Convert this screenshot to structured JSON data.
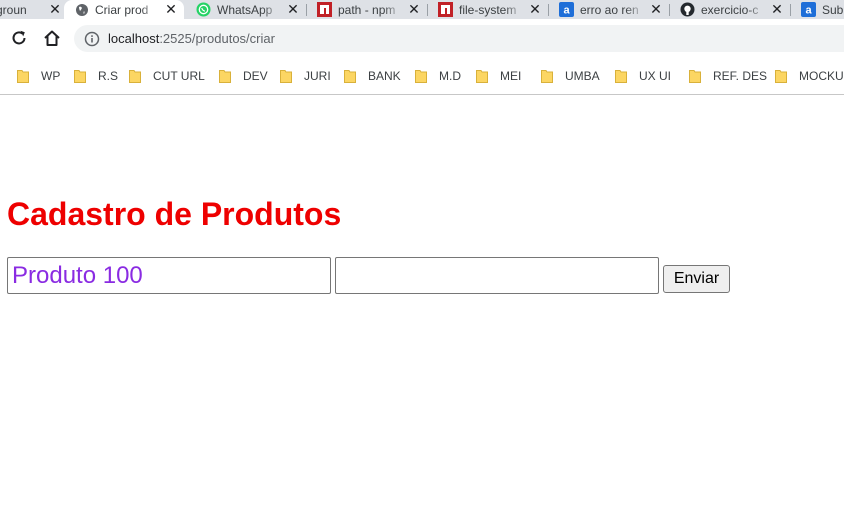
{
  "browser": {
    "tabs": [
      {
        "title": "groun",
        "icon": "none",
        "active": false
      },
      {
        "title": "Criar prod",
        "icon": "globe-icon",
        "active": true
      },
      {
        "title": "WhatsApp",
        "icon": "whatsapp-icon",
        "active": false
      },
      {
        "title": "path - npm",
        "icon": "npm-icon",
        "active": false
      },
      {
        "title": "file-system",
        "icon": "npm-icon",
        "active": false
      },
      {
        "title": "erro ao ren",
        "icon": "a-icon",
        "active": false
      },
      {
        "title": "exercicio-c",
        "icon": "github-icon",
        "active": false
      },
      {
        "title": "Sub",
        "icon": "a-icon",
        "active": false
      }
    ],
    "close_glyph": "✕",
    "url_host": "localhost",
    "url_path": ":2525/produtos/criar",
    "bookmarks": [
      "WP",
      "R.S",
      "CUT URL",
      "DEV",
      "JURI",
      "BANK",
      "M.D",
      "MEI",
      "UMBA",
      "UX UI",
      "REF. DES",
      "MOCKUP"
    ]
  },
  "page": {
    "title": "Cadastro de Produtos",
    "product_name_value": "Produto 100",
    "second_input_value": "",
    "submit_label": "Enviar"
  },
  "colors": {
    "title": "#ee0000",
    "input_text": "#8a2be2",
    "folder": "#fcd663"
  }
}
